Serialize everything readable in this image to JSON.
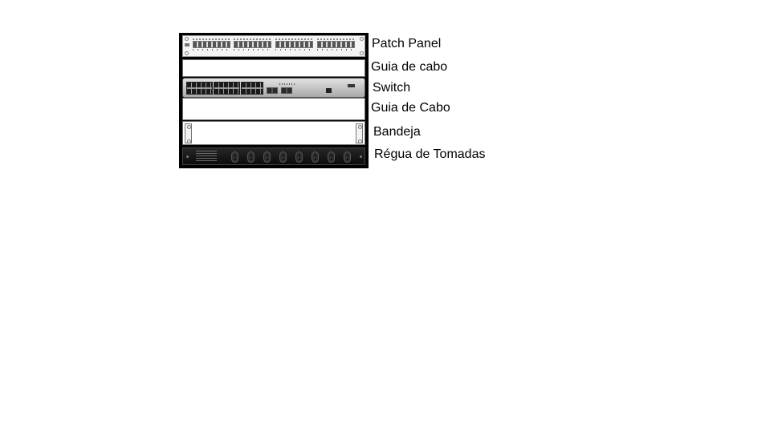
{
  "rack": {
    "components": [
      {
        "id": "patch-panel",
        "label": "Patch Panel"
      },
      {
        "id": "cable-guide-1",
        "label": "Guia de cabo"
      },
      {
        "id": "switch",
        "label": "Switch"
      },
      {
        "id": "cable-guide-2",
        "label": "Guia de Cabo"
      },
      {
        "id": "tray",
        "label": "Bandeja"
      },
      {
        "id": "power-strip",
        "label": "Régua de Tomadas"
      }
    ]
  },
  "colors": {
    "frame": "#000000",
    "power_strip": "#151515",
    "switch_body": "#c9c9c9"
  }
}
